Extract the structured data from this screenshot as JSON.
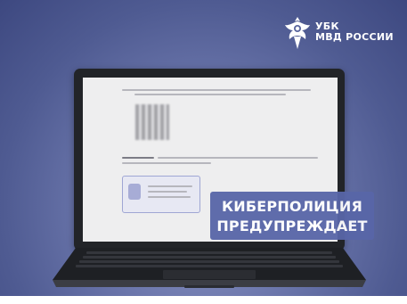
{
  "brand": {
    "org_line1": "УБК",
    "org_line2": "МВД РОССИИ",
    "emblem_icon": "double-headed-eagle-emblem-icon"
  },
  "banner": {
    "line1": "КИБЕРПОЛИЦИЯ",
    "line2": "ПРЕДУПРЕЖДАЕТ"
  },
  "colors": {
    "background": "#5a669e",
    "banner": "#5866a8"
  }
}
